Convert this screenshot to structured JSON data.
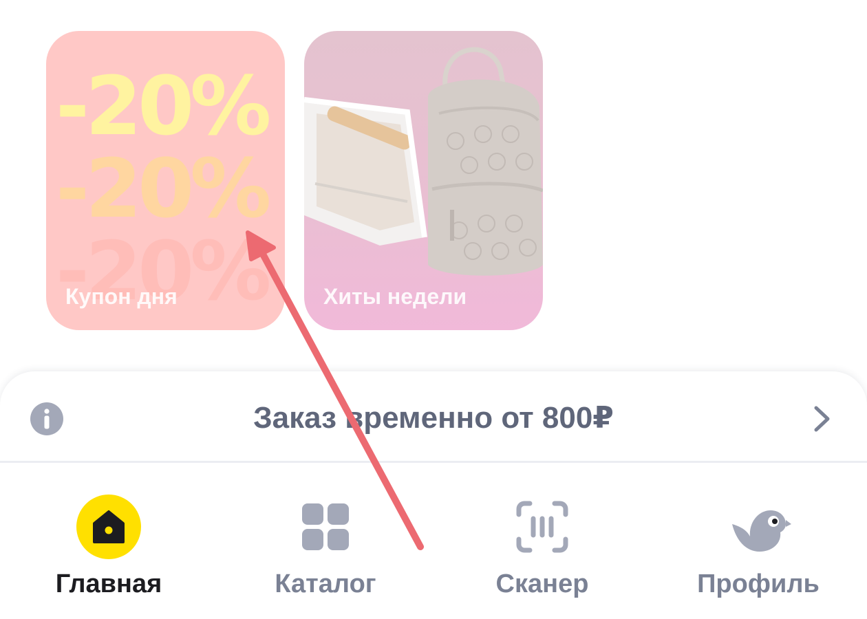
{
  "stories": [
    {
      "label": "Купон дня",
      "badge": "-20%"
    },
    {
      "label": "Хиты недели"
    }
  ],
  "banner": {
    "text": "Заказ временно от 800₽"
  },
  "nav": {
    "items": [
      {
        "label": "Главная",
        "icon": "home-icon",
        "active": true
      },
      {
        "label": "Каталог",
        "icon": "catalog-grid-icon"
      },
      {
        "label": "Сканер",
        "icon": "scanner-icon"
      },
      {
        "label": "Профиль",
        "icon": "bird-profile-icon"
      }
    ]
  },
  "colors": {
    "active_nav": "#ffe000",
    "annotation_arrow": "#ec6a71",
    "icon_gray": "#a3a8b8",
    "text_gray": "#5f667a"
  }
}
